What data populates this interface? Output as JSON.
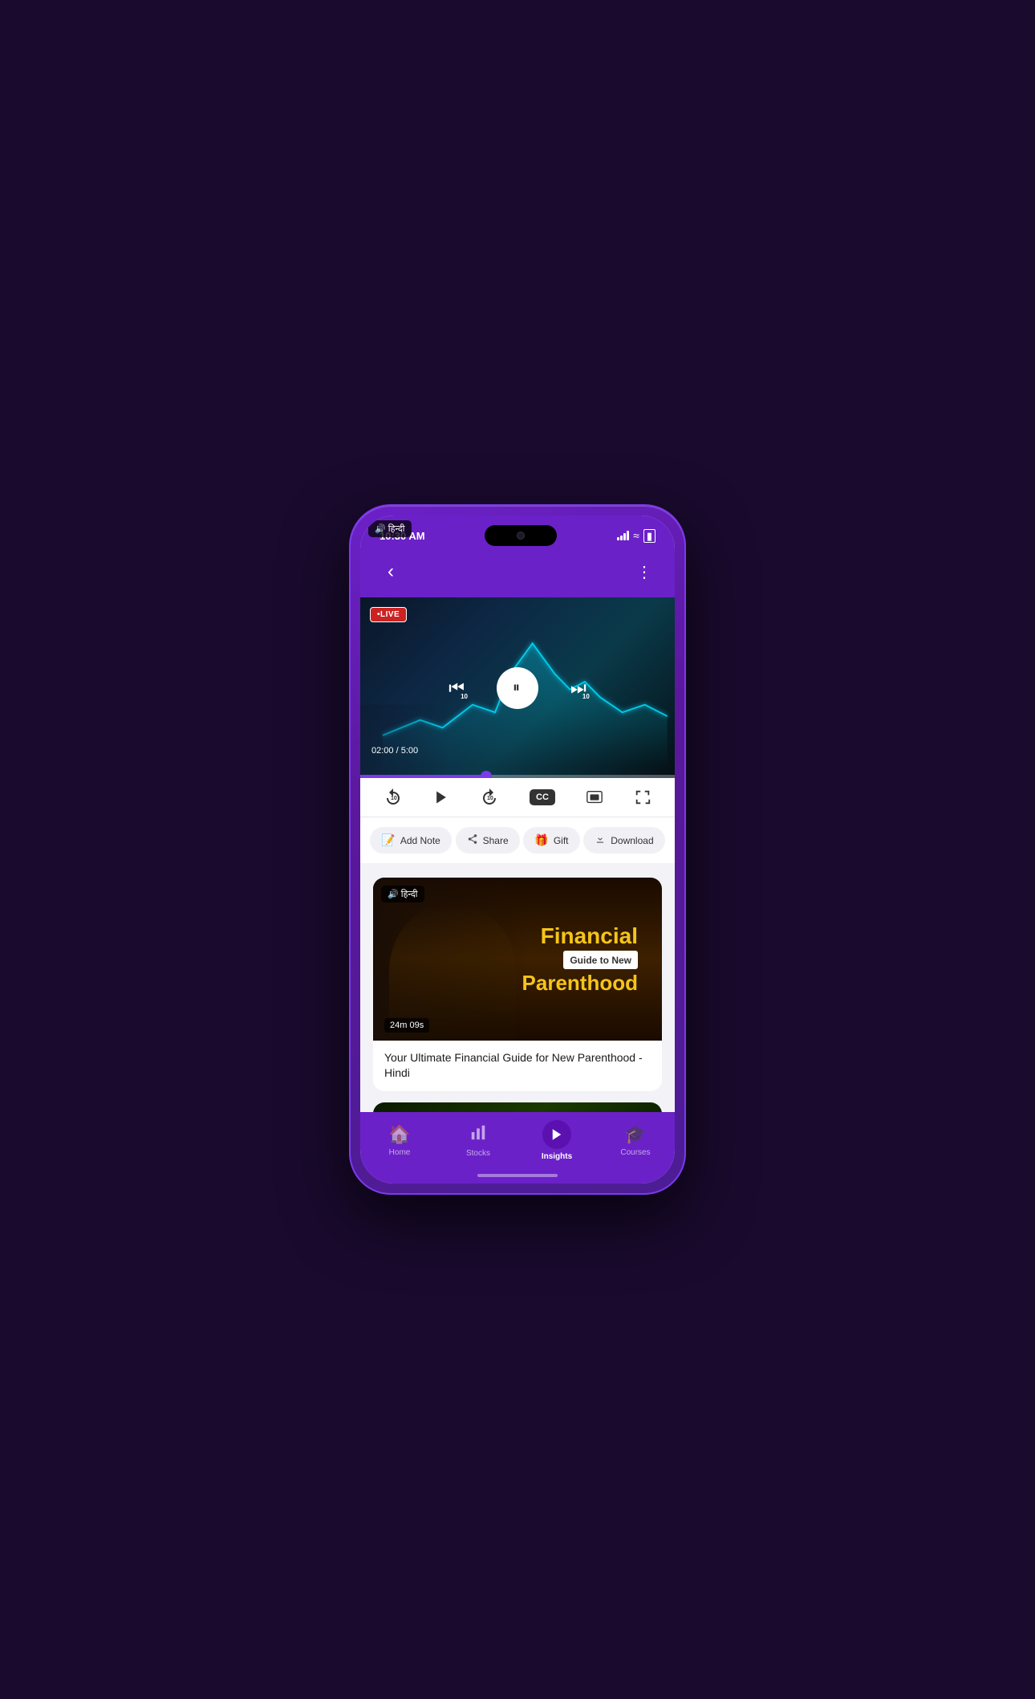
{
  "statusBar": {
    "time": "10:30 AM",
    "batteryIcon": "🔋",
    "wifiIcon": "WiFi",
    "signalIcon": "Signal"
  },
  "topNav": {
    "backLabel": "‹",
    "moreLabel": "⋮"
  },
  "videoPlayer": {
    "liveBadge": "•LIVE",
    "currentTime": "02:00",
    "totalTime": "5:00",
    "timeDisplay": "02:00 / 5:00",
    "progressPercent": 40
  },
  "playerControls": {
    "rewindLabel": "↺",
    "rewindSeconds": "10",
    "playLabel": "▶",
    "forwardLabel": "↻",
    "forwardSeconds": "10",
    "ccLabel": "CC",
    "castLabel": "cast",
    "fullscreenLabel": "⛶"
  },
  "actionBar": {
    "addNote": "Add Note",
    "share": "Share",
    "gift": "Gift",
    "download": "Download"
  },
  "contentCards": [
    {
      "titleMain": "Financial",
      "titleSub": "Guide to New",
      "titleMain2": "Parenthood",
      "duration": "24m 09s",
      "languageBadge": "🔊 हिन्दी",
      "description": "Your Ultimate Financial Guide for New Parenthood - Hindi"
    }
  ],
  "bottomNav": {
    "items": [
      {
        "label": "Home",
        "icon": "🏠",
        "active": false
      },
      {
        "label": "Stocks",
        "icon": "📊",
        "active": false
      },
      {
        "label": "Insights",
        "icon": "▶",
        "active": true
      },
      {
        "label": "Courses",
        "icon": "🎓",
        "active": false
      }
    ]
  }
}
